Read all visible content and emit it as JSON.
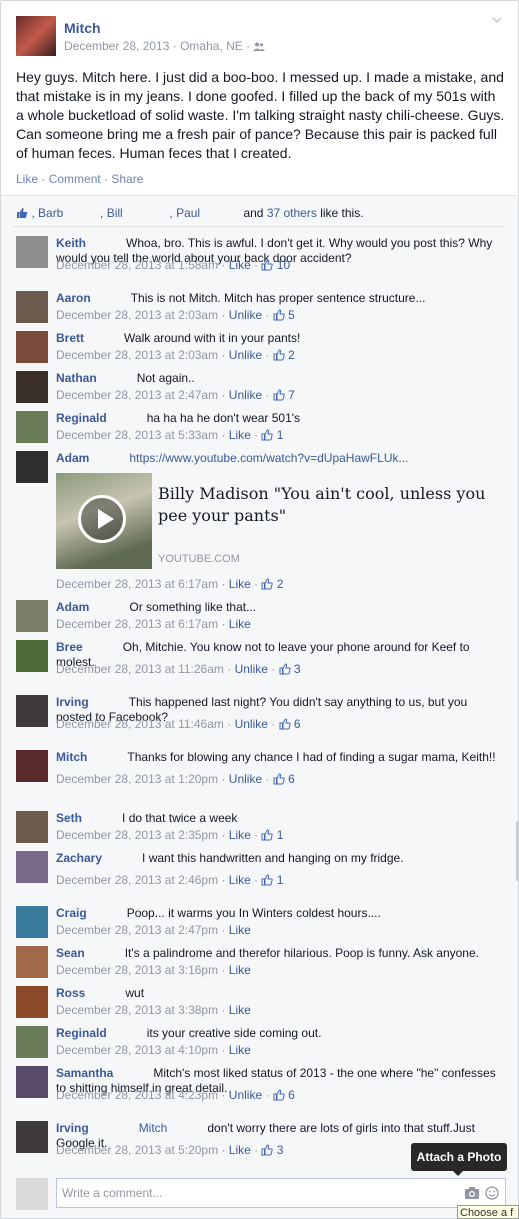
{
  "post": {
    "author": "Mitch",
    "date": "December 28, 2013",
    "location": "Omaha, NE",
    "dot": "·",
    "body": "Hey guys. Mitch here. I just did a boo-boo. I messed up. I made a mistake, and that mistake is in my jeans. I done goofed. I filled up the back of my 501s with a whole bucketload of solid waste. I'm talking straight nasty chili-cheese. Guys. Can someone bring me a fresh pair of pance? Because this pair is packed full of human feces. Human feces that I created.",
    "actions": {
      "like": "Like",
      "comment": "Comment",
      "share": "Share",
      "sep": " · "
    }
  },
  "likes": {
    "names": [
      ", Barb",
      ", Bill",
      ", Paul"
    ],
    "and": "and",
    "others": "37 others",
    "suffix": "like this."
  },
  "comments": [
    {
      "name": "Keith",
      "text": "Whoa, bro. This is awful. I don't get it. Why would you post this? Why would you tell the world about your back door accident?",
      "time": "December 28, 2013 at 1:58am",
      "action": "Like",
      "likes": "10"
    },
    {
      "name": "Aaron",
      "text": "This is not Mitch. Mitch has proper sentence structure...",
      "time": "December 28, 2013 at 2:03am",
      "action": "Unlike",
      "likes": "5"
    },
    {
      "name": "Brett",
      "text": "Walk around with it in your pants!",
      "time": "December 28, 2013 at 2:03am",
      "action": "Unlike",
      "likes": "2"
    },
    {
      "name": "Nathan",
      "text": "Not again..",
      "time": "December 28, 2013 at 2:47am",
      "action": "Unlike",
      "likes": "7"
    },
    {
      "name": "Reginald",
      "text": "ha ha ha he don't wear 501's",
      "time": "December 28, 2013 at 5:33am",
      "action": "Like",
      "likes": "1"
    },
    {
      "name": "Adam",
      "text": "https://www.youtube.com/watch?v=dUpaHawFLUk...",
      "time": "December 28, 2013 at 6:17am",
      "action": "Like",
      "likes": "2",
      "preview": {
        "title": "Billy Madison \"You ain't cool, unless you pee your pants\"",
        "domain": "YOUTUBE.COM"
      }
    },
    {
      "name": "Adam",
      "text": "Or something like that...",
      "time": "December 28, 2013 at 6:17am",
      "action": "Like",
      "likes": ""
    },
    {
      "name": "Bree",
      "text": "Oh, Mitchie. You know not to leave your phone around for Keef to molest.",
      "time": "December 28, 2013 at 11:26am",
      "action": "Unlike",
      "likes": "3"
    },
    {
      "name": "Irving",
      "text": "This happened last night? You didn't say anything to us, but you posted to Facebook?",
      "time": "December 28, 2013 at 11:46am",
      "action": "Unlike",
      "likes": "6"
    },
    {
      "name": "Mitch",
      "text": "Thanks for blowing any chance I had of finding a sugar mama, Keith!!",
      "time": "December 28, 2013 at 1:20pm",
      "action": "Unlike",
      "likes": "6"
    },
    {
      "name": "Seth",
      "text": "I do that twice a week",
      "time": "December 28, 2013 at 2:35pm",
      "action": "Like",
      "likes": "1"
    },
    {
      "name": "Zachary",
      "text": "I want this handwritten and hanging on my fridge.",
      "time": "December 28, 2013 at 2:46pm",
      "action": "Like",
      "likes": "1"
    },
    {
      "name": "Craig",
      "text": "Poop... it warms you In Winters coldest hours....",
      "time": "December 28, 2013 at 2:47pm",
      "action": "Like",
      "likes": ""
    },
    {
      "name": "Sean",
      "text": "It's a palindrome and therefor hilarious. Poop is funny. Ask anyone.",
      "time": "December 28, 2013 at 3:16pm",
      "action": "Like",
      "likes": ""
    },
    {
      "name": "Ross",
      "text": "wut",
      "time": "December 28, 2013 at 3:38pm",
      "action": "Like",
      "likes": ""
    },
    {
      "name": "Reginald",
      "text": "its your creative side coming out.",
      "time": "December 28, 2013 at 4:10pm",
      "action": "Like",
      "likes": ""
    },
    {
      "name": "Samantha",
      "text": "Mitch's most liked status of 2013 - the one where \"he\" confesses to shitting himself in great detail.",
      "time": "December 28, 2013 at 4:23pm",
      "action": "Unlike",
      "likes": "6"
    },
    {
      "name": "Irving",
      "mention": "Mitch",
      "text": "don't worry there are lots of girls into that stuff.Just Google it.",
      "time": "December 28, 2013 at 5:20pm",
      "action": "Like",
      "likes": "3"
    }
  ],
  "composer": {
    "placeholder": "Write a comment..."
  },
  "tooltip": "Attach a Photo",
  "hint": "Choose a f",
  "colors": {
    "link": "#3b5998",
    "meta": "#9197a3",
    "ufi_bg": "#f6f7f9"
  },
  "icons": [
    "audience-icon",
    "chevron-down-icon",
    "thumbs-up-icon",
    "camera-icon",
    "smiley-icon",
    "play-icon"
  ]
}
